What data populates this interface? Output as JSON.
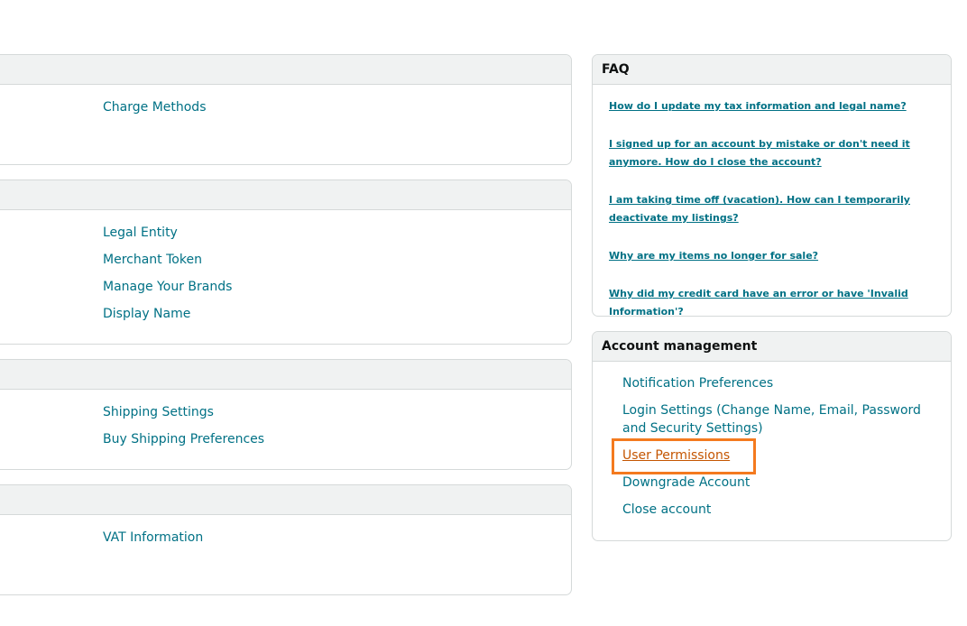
{
  "left_panels": {
    "payments": {
      "links": [
        "Charge Methods"
      ]
    },
    "business": {
      "links": [
        "Legal Entity",
        "Merchant Token",
        "Manage Your Brands",
        "Display Name"
      ]
    },
    "shipping": {
      "links": [
        "Shipping Settings",
        "Buy Shipping Preferences"
      ]
    },
    "tax": {
      "links": [
        "VAT Information"
      ]
    }
  },
  "faq": {
    "title": "FAQ",
    "items": [
      "How do I update my tax information and legal name?",
      "I signed up for an account by mistake or don't need it anymore. How do I close the account?",
      "I am taking time off (vacation). How can I temporarily deactivate my listings?",
      "Why are my items no longer for sale?",
      "Why did my credit card have an error or have 'Invalid Information'?"
    ]
  },
  "account_management": {
    "title": "Account management",
    "items": [
      "Notification Preferences",
      "Login Settings (Change Name, Email, Password and Security Settings)",
      "User Permissions",
      "Downgrade Account",
      "Close account"
    ],
    "highlighted_item": "User Permissions"
  },
  "colors": {
    "link": "#007185",
    "active_link": "#c45500",
    "highlight_border": "#f47a1f",
    "header_bg": "#f0f2f2",
    "border": "#d5d9d9"
  }
}
